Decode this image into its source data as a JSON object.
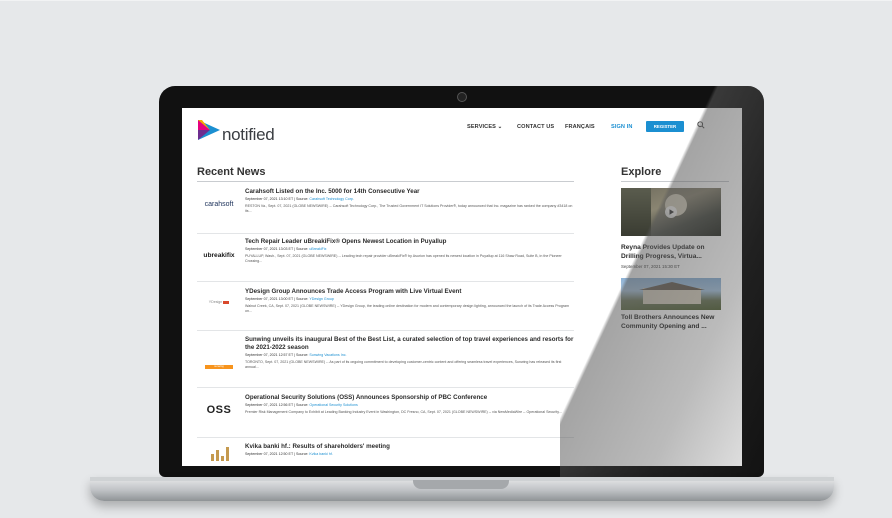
{
  "site": {
    "logo_text": "notified"
  },
  "nav": {
    "services": "SERVICES",
    "contact": "CONTACT US",
    "francais": "FRANÇAIS",
    "signin": "SIGN IN",
    "register": "REGISTER"
  },
  "recent": {
    "title": "Recent News",
    "items": [
      {
        "logo": "carahsoft",
        "headline": "Carahsoft Listed on the Inc. 5000 for 14th Consecutive Year",
        "date": "September 07, 2021 13:10 ET | Source:",
        "source": "Carahsoft Technology Corp.",
        "summary": "RESTON Va., Sept. 07, 2021 (GLOBE NEWSWIRE) -- Carahsoft Technology Corp., The Trusted Government IT Solutions Provider®, today announced that Inc. magazine has ranked the company #3418 on its..."
      },
      {
        "logo": "ubreakifix",
        "headline": "Tech Repair Leader uBreakiFix® Opens Newest Location in Puyallup",
        "date": "September 07, 2021 13:03 ET | Source:",
        "source": "uBreakiFix",
        "summary": "PUYALLUP, Wash., Sept. 07, 2021 (GLOBE NEWSWIRE) -- Leading tech repair provider uBreakiFix® by Asurion has opened its newest location in Puyallup at 116 Shaw Road, Suite B, in the Pioneer Crossing..."
      },
      {
        "logo": "YDesign",
        "headline": "YDesign Group Announces Trade Access Program with Live Virtual Event",
        "date": "September 07, 2021 13:00 ET | Source:",
        "source": "YDesign Group",
        "summary": "Walnut Creek, CA, Sept. 07, 2021 (GLOBE NEWSWIRE) -- YDesign Group, the leading online destination for modern and contemporary design lighting, announced the launch of its Trade Access Program on..."
      },
      {
        "logo": "sunwing",
        "headline": "Sunwing unveils its inaugural Best of the Best List, a curated selection of top travel experiences and resorts for the 2021-2022 season",
        "date": "September 07, 2021 12:57 ET | Source:",
        "source": "Sunwing Vacations Inc.",
        "summary": "TORONTO, Sept. 07, 2021 (GLOBE NEWSWIRE) -- As part of its ongoing commitment to developing customer-centric content and offering seamless travel experiences, Sunwing has released its first annual..."
      },
      {
        "logo": "OSS",
        "headline": "Operational Security Solutions (OSS) Announces Sponsorship of PBC Conference",
        "date": "September 07, 2021 12:56 ET | Source:",
        "source": "Operational Security Solutions",
        "summary": "Premier Risk Management Company to Exhibit at Leading Banking Industry Event in Washington, DC Fresno, CA, Sept. 07, 2021 (GLOBE NEWSWIRE) -- via NewMediaWire -- Operational Security..."
      },
      {
        "logo": "kvika",
        "headline": "Kvika banki hf.: Results of shareholders' meeting",
        "date": "September 07, 2021 12:50 ET | Source:",
        "source": "Kvika banki hf.",
        "summary": ""
      }
    ]
  },
  "explore": {
    "title": "Explore",
    "items": [
      {
        "caption": "Reyna Provides Update on Drilling Progress, Virtua...",
        "date": "September 07, 2021 15:30 ET"
      },
      {
        "caption": "Toll Brothers Announces New Community Opening and ...",
        "date": ""
      }
    ]
  },
  "colors": {
    "accent": "#1b8fd1",
    "text": "#2b2b2b"
  }
}
